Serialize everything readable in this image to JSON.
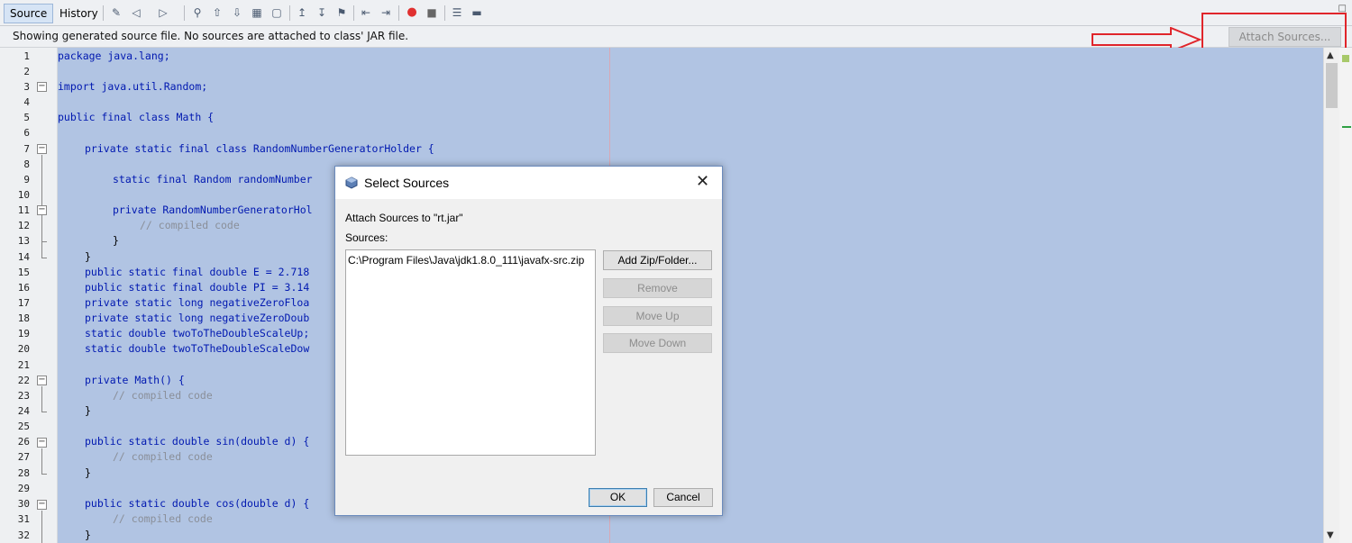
{
  "tabs": [
    {
      "label": "Source",
      "active": true
    },
    {
      "label": "History",
      "active": false
    }
  ],
  "toolbar_icons": [
    "last-edit-icon",
    "back-icon",
    "forward-icon",
    "find-selection-icon",
    "find-previous-icon",
    "find-next-icon",
    "toggle-highlight-icon",
    "toggle-rect-selection-icon",
    "previous-bookmark-icon",
    "next-bookmark-icon",
    "toggle-bookmark-icon",
    "shift-left-icon",
    "shift-right-icon",
    "start-macro-icon",
    "stop-macro-icon",
    "comment-icon",
    "uncomment-icon"
  ],
  "infobar": {
    "message": "Showing generated source file. No sources are attached to class' JAR file.",
    "attach_button": "Attach Sources..."
  },
  "annotation_color": "#e0252b",
  "line_numbers": [
    "1",
    "2",
    "3",
    "4",
    "5",
    "6",
    "7",
    "8",
    "9",
    "10",
    "11",
    "12",
    "13",
    "14",
    "15",
    "16",
    "17",
    "18",
    "19",
    "20",
    "21",
    "22",
    "23",
    "24",
    "25",
    "26",
    "27",
    "28",
    "29",
    "30",
    "31",
    "32"
  ],
  "code": {
    "l1": "package java.lang;",
    "l3": "import java.util.Random;",
    "l5": "public final class Math {",
    "l7": "private static final class RandomNumberGeneratorHolder {",
    "l9": "static final Random randomNumber",
    "l11": "private RandomNumberGeneratorHol",
    "l12": "// compiled code",
    "l13": "}",
    "l14": "}",
    "l15": "public static final double E = 2.718",
    "l16": "public static final double PI = 3.14",
    "l17": "private static long negativeZeroFloa",
    "l18": "private static long negativeZeroDoub",
    "l19": "static double twoToTheDoubleScaleUp;",
    "l20": "static double twoToTheDoubleScaleDow",
    "l22": "private Math() {",
    "l23": "// compiled code",
    "l24": "}",
    "l26": "public static double sin(double d) {",
    "l27": "// compiled code",
    "l28": "}",
    "l30": "public static double cos(double d) {",
    "l31": "// compiled code",
    "l32": "}"
  },
  "dialog": {
    "title": "Select Sources",
    "heading": "Attach Sources to \"rt.jar\"",
    "sources_label": "Sources:",
    "sources": [
      "C:\\Program Files\\Java\\jdk1.8.0_111\\javafx-src.zip"
    ],
    "buttons": {
      "add": "Add Zip/Folder...",
      "remove": "Remove",
      "move_up": "Move Up",
      "move_down": "Move Down"
    },
    "ok": "OK",
    "cancel": "Cancel"
  }
}
